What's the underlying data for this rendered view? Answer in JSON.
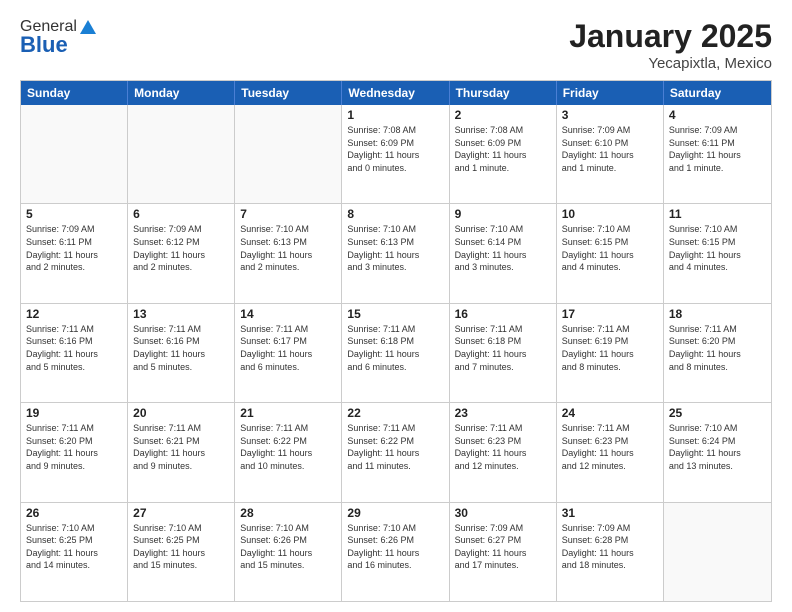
{
  "logo": {
    "line1": "General",
    "line2": "Blue"
  },
  "header": {
    "month": "January 2025",
    "location": "Yecapixtla, Mexico"
  },
  "weekdays": [
    "Sunday",
    "Monday",
    "Tuesday",
    "Wednesday",
    "Thursday",
    "Friday",
    "Saturday"
  ],
  "rows": [
    [
      {
        "day": "",
        "info": ""
      },
      {
        "day": "",
        "info": ""
      },
      {
        "day": "",
        "info": ""
      },
      {
        "day": "1",
        "info": "Sunrise: 7:08 AM\nSunset: 6:09 PM\nDaylight: 11 hours\nand 0 minutes."
      },
      {
        "day": "2",
        "info": "Sunrise: 7:08 AM\nSunset: 6:09 PM\nDaylight: 11 hours\nand 1 minute."
      },
      {
        "day": "3",
        "info": "Sunrise: 7:09 AM\nSunset: 6:10 PM\nDaylight: 11 hours\nand 1 minute."
      },
      {
        "day": "4",
        "info": "Sunrise: 7:09 AM\nSunset: 6:11 PM\nDaylight: 11 hours\nand 1 minute."
      }
    ],
    [
      {
        "day": "5",
        "info": "Sunrise: 7:09 AM\nSunset: 6:11 PM\nDaylight: 11 hours\nand 2 minutes."
      },
      {
        "day": "6",
        "info": "Sunrise: 7:09 AM\nSunset: 6:12 PM\nDaylight: 11 hours\nand 2 minutes."
      },
      {
        "day": "7",
        "info": "Sunrise: 7:10 AM\nSunset: 6:13 PM\nDaylight: 11 hours\nand 2 minutes."
      },
      {
        "day": "8",
        "info": "Sunrise: 7:10 AM\nSunset: 6:13 PM\nDaylight: 11 hours\nand 3 minutes."
      },
      {
        "day": "9",
        "info": "Sunrise: 7:10 AM\nSunset: 6:14 PM\nDaylight: 11 hours\nand 3 minutes."
      },
      {
        "day": "10",
        "info": "Sunrise: 7:10 AM\nSunset: 6:15 PM\nDaylight: 11 hours\nand 4 minutes."
      },
      {
        "day": "11",
        "info": "Sunrise: 7:10 AM\nSunset: 6:15 PM\nDaylight: 11 hours\nand 4 minutes."
      }
    ],
    [
      {
        "day": "12",
        "info": "Sunrise: 7:11 AM\nSunset: 6:16 PM\nDaylight: 11 hours\nand 5 minutes."
      },
      {
        "day": "13",
        "info": "Sunrise: 7:11 AM\nSunset: 6:16 PM\nDaylight: 11 hours\nand 5 minutes."
      },
      {
        "day": "14",
        "info": "Sunrise: 7:11 AM\nSunset: 6:17 PM\nDaylight: 11 hours\nand 6 minutes."
      },
      {
        "day": "15",
        "info": "Sunrise: 7:11 AM\nSunset: 6:18 PM\nDaylight: 11 hours\nand 6 minutes."
      },
      {
        "day": "16",
        "info": "Sunrise: 7:11 AM\nSunset: 6:18 PM\nDaylight: 11 hours\nand 7 minutes."
      },
      {
        "day": "17",
        "info": "Sunrise: 7:11 AM\nSunset: 6:19 PM\nDaylight: 11 hours\nand 8 minutes."
      },
      {
        "day": "18",
        "info": "Sunrise: 7:11 AM\nSunset: 6:20 PM\nDaylight: 11 hours\nand 8 minutes."
      }
    ],
    [
      {
        "day": "19",
        "info": "Sunrise: 7:11 AM\nSunset: 6:20 PM\nDaylight: 11 hours\nand 9 minutes."
      },
      {
        "day": "20",
        "info": "Sunrise: 7:11 AM\nSunset: 6:21 PM\nDaylight: 11 hours\nand 9 minutes."
      },
      {
        "day": "21",
        "info": "Sunrise: 7:11 AM\nSunset: 6:22 PM\nDaylight: 11 hours\nand 10 minutes."
      },
      {
        "day": "22",
        "info": "Sunrise: 7:11 AM\nSunset: 6:22 PM\nDaylight: 11 hours\nand 11 minutes."
      },
      {
        "day": "23",
        "info": "Sunrise: 7:11 AM\nSunset: 6:23 PM\nDaylight: 11 hours\nand 12 minutes."
      },
      {
        "day": "24",
        "info": "Sunrise: 7:11 AM\nSunset: 6:23 PM\nDaylight: 11 hours\nand 12 minutes."
      },
      {
        "day": "25",
        "info": "Sunrise: 7:10 AM\nSunset: 6:24 PM\nDaylight: 11 hours\nand 13 minutes."
      }
    ],
    [
      {
        "day": "26",
        "info": "Sunrise: 7:10 AM\nSunset: 6:25 PM\nDaylight: 11 hours\nand 14 minutes."
      },
      {
        "day": "27",
        "info": "Sunrise: 7:10 AM\nSunset: 6:25 PM\nDaylight: 11 hours\nand 15 minutes."
      },
      {
        "day": "28",
        "info": "Sunrise: 7:10 AM\nSunset: 6:26 PM\nDaylight: 11 hours\nand 15 minutes."
      },
      {
        "day": "29",
        "info": "Sunrise: 7:10 AM\nSunset: 6:26 PM\nDaylight: 11 hours\nand 16 minutes."
      },
      {
        "day": "30",
        "info": "Sunrise: 7:09 AM\nSunset: 6:27 PM\nDaylight: 11 hours\nand 17 minutes."
      },
      {
        "day": "31",
        "info": "Sunrise: 7:09 AM\nSunset: 6:28 PM\nDaylight: 11 hours\nand 18 minutes."
      },
      {
        "day": "",
        "info": ""
      }
    ]
  ]
}
